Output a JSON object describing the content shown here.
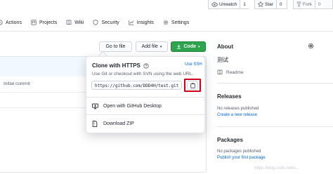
{
  "repo_actions": {
    "watch_label": "Unwatch",
    "watch_count": "1",
    "star_label": "Star",
    "star_count": "0",
    "fork_label": "Fork",
    "fork_count": "0"
  },
  "nav": {
    "items": [
      {
        "label": "Actions",
        "icon": "play-icon"
      },
      {
        "label": "Projects",
        "icon": "project-board-icon"
      },
      {
        "label": "Wiki",
        "icon": "book-icon"
      },
      {
        "label": "Security",
        "icon": "shield-icon"
      },
      {
        "label": "Insights",
        "icon": "graph-icon"
      },
      {
        "label": "Settings",
        "icon": "gear-icon"
      }
    ]
  },
  "toolbar": {
    "go_to_file": "Go to file",
    "add_file": "Add file",
    "code": "Code"
  },
  "files": {
    "commit_message": "Initial commit"
  },
  "clone": {
    "title": "Clone with HTTPS",
    "use_ssh": "Use SSH",
    "description": "Use Git or checkout with SVN using the web URL.",
    "url": "https://github.com/DDD4H/test.git",
    "open_desktop": "Open with GitHub Desktop",
    "download_zip": "Download ZIP"
  },
  "about": {
    "title": "About",
    "description": "测试",
    "readme": "Readme"
  },
  "releases": {
    "title": "Releases",
    "none": "No releases published",
    "create": "Create a new release"
  },
  "packages": {
    "title": "Packages",
    "none": "No packages published",
    "publish": "Publish your first package"
  },
  "watermark": "https://blog.csdn.net/u..."
}
